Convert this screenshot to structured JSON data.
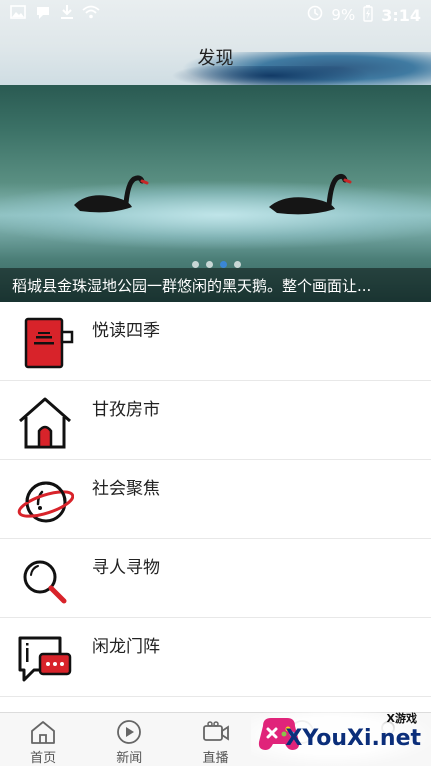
{
  "status": {
    "battery": "9%",
    "time": "3:14",
    "icons": [
      "image-icon",
      "notification-icon",
      "download-icon",
      "wifi-icon",
      "clock-icon",
      "battery-icon"
    ]
  },
  "header": {
    "title": "发现"
  },
  "banner": {
    "caption": "稻城县金珠湿地公园一群悠闲的黑天鹅。整个画面让...",
    "slide_count": 4,
    "active_slide": 3
  },
  "list": [
    {
      "label": "悦读四季",
      "icon": "book-icon"
    },
    {
      "label": "甘孜房市",
      "icon": "house-icon"
    },
    {
      "label": "社会聚焦",
      "icon": "planet-icon"
    },
    {
      "label": "寻人寻物",
      "icon": "magnifier-icon"
    },
    {
      "label": "闲龙门阵",
      "icon": "chat-icon"
    }
  ],
  "tabbar": {
    "tabs": [
      {
        "label": "首页",
        "icon": "home-icon"
      },
      {
        "label": "新闻",
        "icon": "play-icon"
      },
      {
        "label": "直播",
        "icon": "video-icon"
      },
      {
        "label": "",
        "icon": "discover-icon"
      },
      {
        "label": "",
        "icon": "profile-icon"
      }
    ]
  },
  "watermark": {
    "small": "X游戏",
    "big": "XYouXi.net"
  },
  "colors": {
    "accent_red": "#d8232a",
    "tab_text": "#555555",
    "dot_active": "#3a86d6"
  }
}
